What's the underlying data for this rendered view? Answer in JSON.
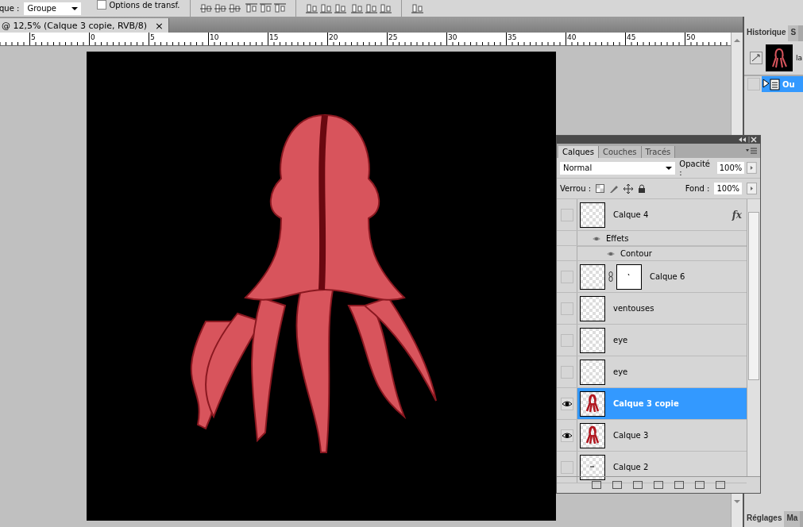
{
  "options_bar": {
    "label": "que :",
    "dropdown": "Groupe",
    "checkbox": {
      "label": "Options de transf.",
      "checked": false
    }
  },
  "document": {
    "tab": {
      "title": "@ 12,5% (Calque 3 copie, RVB/8)",
      "close": "×"
    },
    "ruler": [
      "5",
      "0",
      "5",
      "10",
      "15",
      "20",
      "25",
      "30",
      "35",
      "40",
      "45",
      "50"
    ]
  },
  "history": {
    "tabs": [
      {
        "label": "Historique",
        "selected": true
      },
      {
        "label": "S",
        "selected": false
      }
    ],
    "snapshot": {
      "label": "la"
    },
    "states": [
      {
        "label": "Ou",
        "selected": true
      }
    ]
  },
  "layers_panel": {
    "tabs": [
      {
        "label": "Calques",
        "selected": true
      },
      {
        "label": "Couches",
        "selected": false
      },
      {
        "label": "Tracés",
        "selected": false
      }
    ],
    "blend_mode": "Normal",
    "opacity_label": "Opacité :",
    "opacity": "100%",
    "lock_label": "Verrou :",
    "fill_label": "Fond :",
    "fill": "100%",
    "layers": [
      {
        "name": "Calque 4",
        "visible": false,
        "selected": false,
        "kind": "empty",
        "fx": "fx",
        "children": [
          {
            "name": "Effets",
            "children": [
              {
                "name": "Contour"
              }
            ]
          }
        ]
      },
      {
        "name": "Calque 6",
        "visible": false,
        "selected": false,
        "kind": "empty",
        "mask": true
      },
      {
        "name": "ventouses",
        "visible": false,
        "selected": false,
        "kind": "empty"
      },
      {
        "name": "eye",
        "visible": false,
        "selected": false,
        "kind": "empty"
      },
      {
        "name": "eye",
        "visible": false,
        "selected": false,
        "kind": "empty"
      },
      {
        "name": "Calque 3 copie",
        "visible": true,
        "selected": true,
        "kind": "octopus"
      },
      {
        "name": "Calque 3",
        "visible": true,
        "selected": false,
        "kind": "octopus"
      },
      {
        "name": "Calque 2",
        "visible": false,
        "selected": false,
        "kind": "dash"
      }
    ]
  },
  "dock_bottom": {
    "tabs": [
      {
        "label": "Réglages",
        "selected": true
      },
      {
        "label": "Ma",
        "selected": false
      }
    ]
  }
}
